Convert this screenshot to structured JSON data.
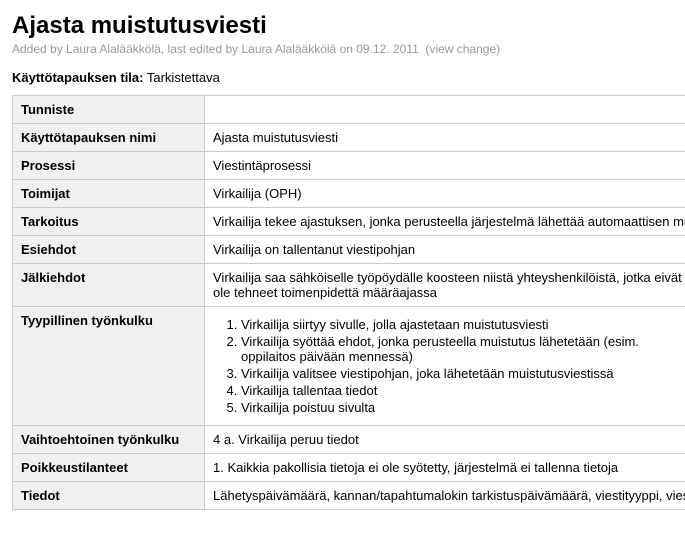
{
  "title": "Ajasta muistutusviesti",
  "meta": {
    "added_by_label": "Added by ",
    "added_by": "Laura Alalääkkölä",
    "edited_label": ", last edited by ",
    "edited_by": "Laura Alalääkkölä",
    "on_label": " on ",
    "date": "09.12. 2011",
    "view_change": "view change"
  },
  "status": {
    "label": "Käyttötapauksen tila:",
    "value": "Tarkistettava"
  },
  "rows": {
    "tunniste": {
      "label": "Tunniste",
      "value": ""
    },
    "nimi": {
      "label": "Käyttötapauksen nimi",
      "value": "Ajasta muistutusviesti"
    },
    "prosessi": {
      "label": "Prosessi",
      "value": "Viestintäprosessi"
    },
    "toimijat": {
      "label": "Toimijat",
      "value": "Virkailija (OPH)"
    },
    "tarkoitus": {
      "label": "Tarkoitus",
      "value": "Virkailija tekee ajastuksen, jonka perusteella järjestelmä lähettää automaattisen muistutusviestin"
    },
    "esiehdot": {
      "label": "Esiehdot",
      "value": "Virkailija on tallentanut viestipohjan"
    },
    "jalkiehdot": {
      "label": "Jälkiehdot",
      "value": "Virkailija saa sähköiselle työpöydälle koosteen niistä yhteyshenkilöistä, jotka eivät ole tehneet toimenpidettä määräajassa"
    },
    "tyynkulku": {
      "label": "Tyypillinen työnkulku",
      "steps": [
        "Virkailija siirtyy sivulle, jolla ajastetaan muistutusviesti",
        "Virkailija syöttää ehdot, jonka perusteella muistutus lähetetään (esim. oppilaitos päivään mennessä)",
        "Virkailija valitsee viestipohjan, joka lähetetään muistutusviestissä",
        "Virkailija tallentaa tiedot",
        "Virkailija poistuu sivulta"
      ]
    },
    "vaihtoehto": {
      "label": "Vaihtoehtoinen työnkulku",
      "value": "4 a. Virkailija peruu tiedot"
    },
    "poikkeus": {
      "label": "Poikkeustilanteet",
      "value": "1. Kaikkia pakollisia tietoja ei ole syötetty, järjestelmä ei tallenna tietoja"
    },
    "tiedot": {
      "label": "Tiedot",
      "value": "Lähetyspäivämäärä, kannan/tapahtumalokin tarkistuspäivämäärä, viestityyppi, viestipohja"
    }
  }
}
